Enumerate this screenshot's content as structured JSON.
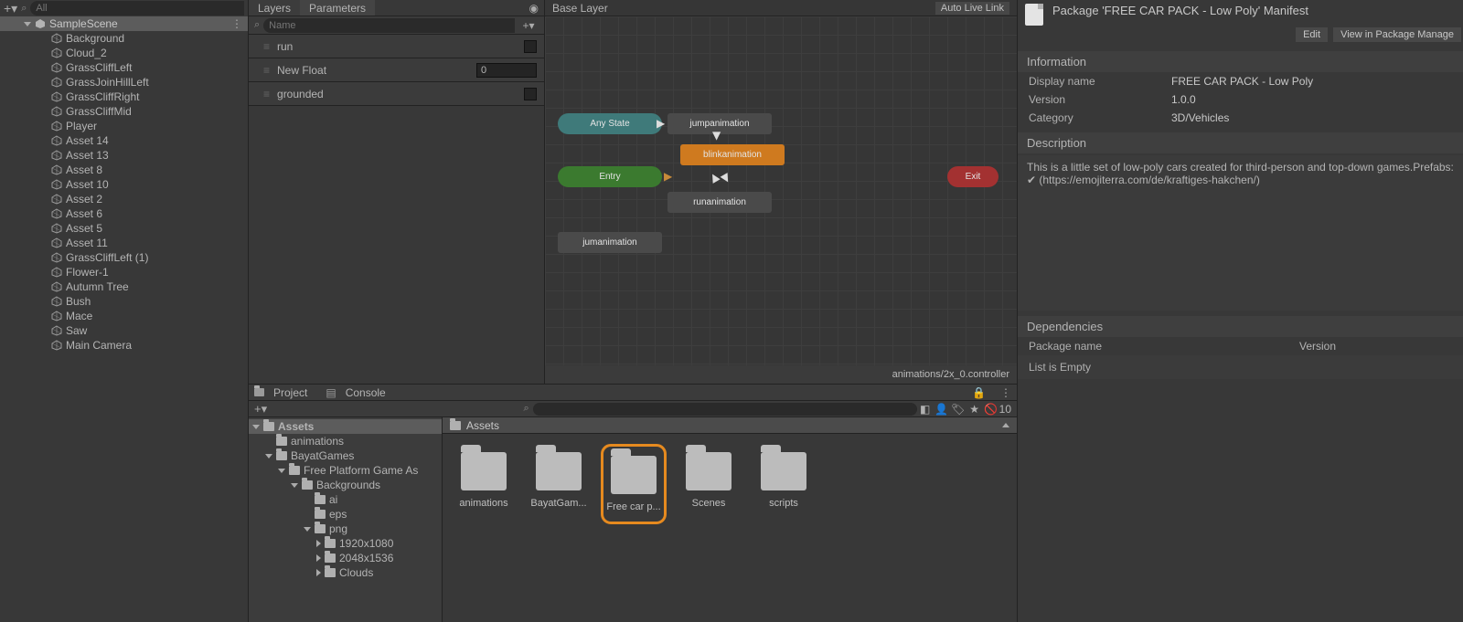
{
  "hierarchy": {
    "search_placeholder": "All",
    "scene": "SampleScene",
    "items": [
      "Background",
      "Cloud_2",
      "GrassCliffLeft",
      "GrassJoinHillLeft",
      "GrassCliffRight",
      "GrassCliffMid",
      "Player",
      "Asset 14",
      "Asset 13",
      "Asset 8",
      "Asset 10",
      "Asset 2",
      "Asset 6",
      "Asset 5",
      "Asset 11",
      "GrassCliffLeft (1)",
      "Flower-1",
      "Autumn Tree",
      "Bush",
      "Mace",
      "Saw",
      "Main Camera"
    ]
  },
  "animator": {
    "tabs": {
      "layers": "Layers",
      "parameters": "Parameters"
    },
    "name_placeholder": "Name",
    "params": [
      {
        "name": "run",
        "type": "bool",
        "value": ""
      },
      {
        "name": "New Float",
        "type": "float",
        "value": "0"
      },
      {
        "name": "grounded",
        "type": "bool",
        "value": ""
      }
    ],
    "base_layer": "Base Layer",
    "auto_live": "Auto Live Link",
    "nodes": {
      "any": "Any State",
      "entry": "Entry",
      "exit": "Exit",
      "jump": "jumpanimation",
      "blink": "blinkanimation",
      "run": "runanimation",
      "jum": "jumanimation"
    },
    "footer": "animations/2x_0.controller"
  },
  "project": {
    "tabs": {
      "project": "Project",
      "console": "Console"
    },
    "hidden_count": "10",
    "tree": {
      "assets": "Assets",
      "items": [
        {
          "l": "animations",
          "d": 1,
          "expand": "none"
        },
        {
          "l": "BayatGames",
          "d": 1,
          "expand": "down"
        },
        {
          "l": "Free Platform Game As",
          "d": 2,
          "expand": "down"
        },
        {
          "l": "Backgrounds",
          "d": 3,
          "expand": "down"
        },
        {
          "l": "ai",
          "d": 4,
          "expand": "none"
        },
        {
          "l": "eps",
          "d": 4,
          "expand": "none"
        },
        {
          "l": "png",
          "d": 4,
          "expand": "down"
        },
        {
          "l": "1920x1080",
          "d": 5,
          "expand": "right"
        },
        {
          "l": "2048x1536",
          "d": 5,
          "expand": "right"
        },
        {
          "l": "Clouds",
          "d": 5,
          "expand": "right"
        }
      ]
    },
    "breadcrumb": "Assets",
    "folders": [
      {
        "name": "animations",
        "sel": false
      },
      {
        "name": "BayatGam...",
        "sel": false
      },
      {
        "name": "Free car p...",
        "sel": true
      },
      {
        "name": "Scenes",
        "sel": false
      },
      {
        "name": "scripts",
        "sel": false
      }
    ]
  },
  "inspector": {
    "title": "Package 'FREE CAR PACK - Low Poly' Manifest",
    "btn_edit": "Edit",
    "btn_view": "View in Package Manage",
    "section_info": "Information",
    "fields": {
      "display_name_k": "Display name",
      "display_name_v": "FREE CAR PACK - Low Poly",
      "version_k": "Version",
      "version_v": "1.0.0",
      "category_k": "Category",
      "category_v": "3D/Vehicles"
    },
    "section_desc": "Description",
    "desc": "This is a little set of low-poly cars created for third-person and top-down games.Prefabs: ✔ (https://emojiterra.com/de/kraftiges-hakchen/)",
    "section_dep": "Dependencies",
    "dep_pkg": "Package name",
    "dep_ver": "Version",
    "dep_empty": "List is Empty"
  }
}
